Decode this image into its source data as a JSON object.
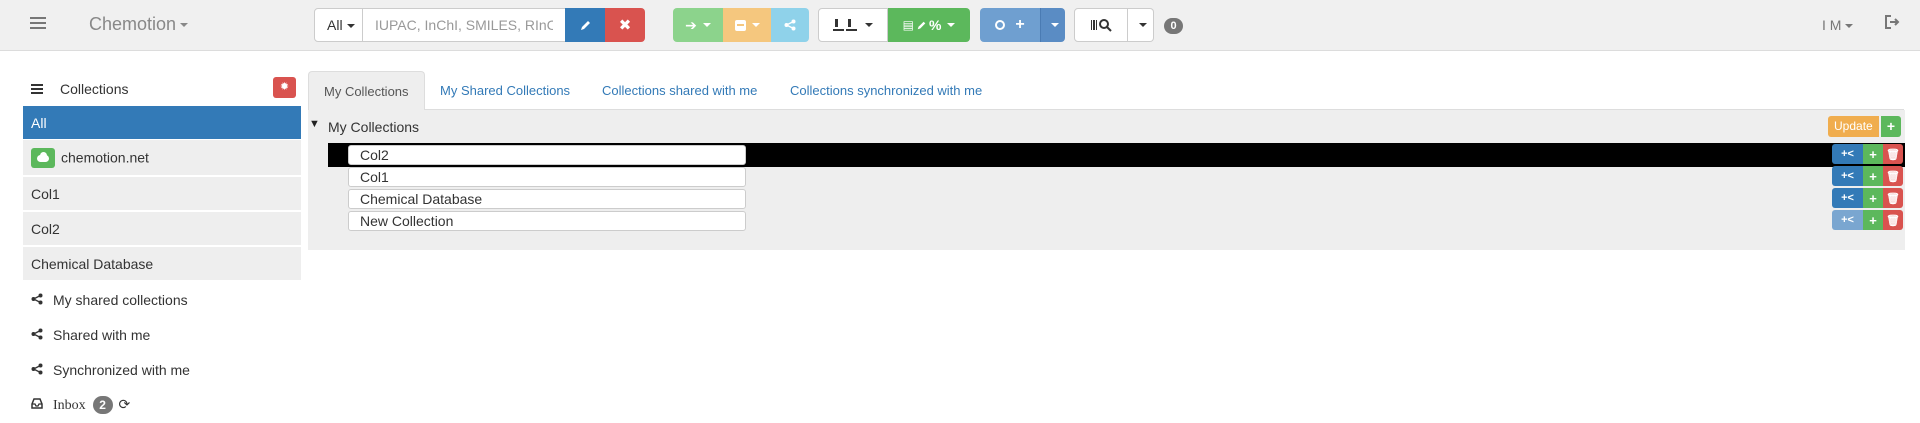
{
  "navbar": {
    "brand": "Chemotion",
    "search": {
      "scope": "All",
      "placeholder": "IUPAC, InChI, SMILES, RInChI"
    },
    "notification_count": "0",
    "user_initials": "I M"
  },
  "sidebar": {
    "header": "Collections",
    "items": [
      {
        "label": "All"
      },
      {
        "label": "chemotion.net"
      },
      {
        "label": "Col1"
      },
      {
        "label": "Col2"
      },
      {
        "label": "Chemical Database"
      }
    ],
    "links": [
      {
        "label": "My shared collections"
      },
      {
        "label": "Shared with me"
      },
      {
        "label": "Synchronized with me"
      }
    ],
    "inbox": {
      "label": "Inbox",
      "count": "2"
    }
  },
  "tabs": [
    {
      "label": "My Collections"
    },
    {
      "label": "My Shared Collections"
    },
    {
      "label": "Collections shared with me"
    },
    {
      "label": "Collections synchronized with me"
    }
  ],
  "tree": {
    "root_label": "My Collections",
    "update_label": "Update",
    "collections": [
      {
        "name": "Col2"
      },
      {
        "name": "Col1"
      },
      {
        "name": "Chemical Database"
      },
      {
        "name": "New Collection"
      }
    ]
  },
  "colors": {
    "primary": "#337ab7",
    "success": "#5cb85c",
    "danger": "#d9534f",
    "warning": "#f0ad4e",
    "info": "#5bc0de"
  }
}
